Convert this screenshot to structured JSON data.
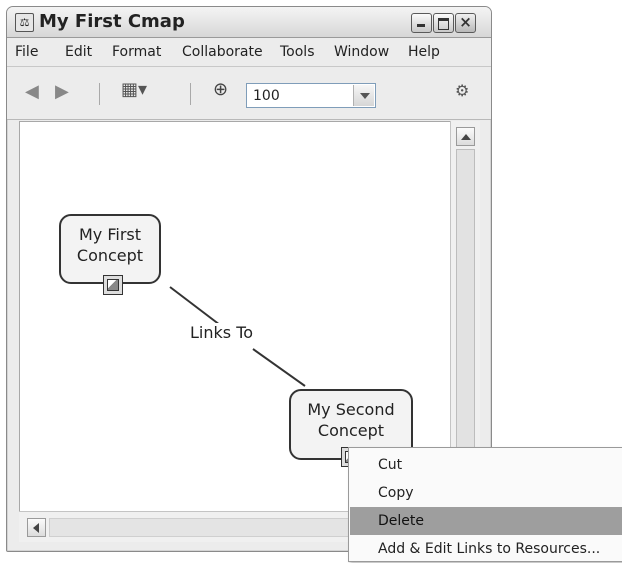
{
  "window": {
    "title": "My First Cmap"
  },
  "menu": [
    "File",
    "Edit",
    "Format",
    "Collaborate",
    "Tools",
    "Window",
    "Help"
  ],
  "toolbar": {
    "zoom_value": "100"
  },
  "concepts": [
    {
      "line1": "My First",
      "line2": "Concept"
    },
    {
      "line1": "My Second",
      "line2": "Concept"
    }
  ],
  "link": {
    "label": "Links To"
  },
  "context_menu": {
    "items": [
      "Cut",
      "Copy",
      "Delete",
      "Add & Edit Links to Resources..."
    ],
    "highlighted": "Delete"
  }
}
